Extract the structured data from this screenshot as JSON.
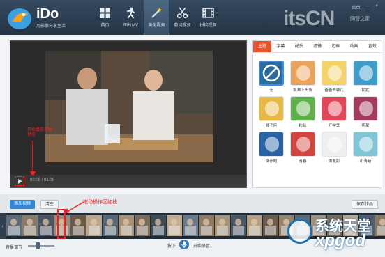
{
  "app": {
    "name": "iDo",
    "slogan": "用影像分享生活"
  },
  "nav": [
    {
      "label": "首页",
      "icon": "grid-icon"
    },
    {
      "label": "图片MV",
      "icon": "dance-icon"
    },
    {
      "label": "美化视频",
      "icon": "magic-wand-icon",
      "active": true
    },
    {
      "label": "剪切视频",
      "icon": "scissors-icon"
    },
    {
      "label": "拼接视频",
      "icon": "film-icon"
    }
  ],
  "top_links": [
    "菜单",
    "—",
    "×"
  ],
  "watermark_top": {
    "main": "itsCN",
    "sub": "网管之家"
  },
  "player": {
    "timecode": "00:08 / 01:08",
    "play_icon": "play-icon",
    "annotation": "开始播放视频预览"
  },
  "tabs": [
    "主题",
    "字幕",
    "配乐",
    "滤镜",
    "边框",
    "动画",
    "音效"
  ],
  "themes": [
    {
      "label": "无",
      "color": "#2d6b9c",
      "selected": true
    },
    {
      "label": "凯蒂上头条",
      "color": "#e9a35a"
    },
    {
      "label": "爸爸去哪儿",
      "color": "#f3d36a"
    },
    {
      "label": "钥匙",
      "color": "#3f9bc9"
    },
    {
      "label": "狮子座",
      "color": "#e6b844"
    },
    {
      "label": "粉丝",
      "color": "#5fb24a"
    },
    {
      "label": "开学季",
      "color": "#e4465a"
    },
    {
      "label": "明星",
      "color": "#a43a5c"
    },
    {
      "label": "倒计时",
      "color": "#2a62a6"
    },
    {
      "label": "青春",
      "color": "#d2443c"
    },
    {
      "label": "微电影",
      "color": "#efefef"
    },
    {
      "label": "小清新",
      "color": "#7fc5d6"
    }
  ],
  "toolbar": {
    "add_label": "添加视频",
    "clear_label": "清空",
    "save_label": "保存作品",
    "annotation": "拖动操作区红线"
  },
  "timeline": {
    "frame_colors": [
      "#5c6b7a",
      "#8a7a6a",
      "#4d5560",
      "#9c8a74",
      "#6b5a48",
      "#b9a68c",
      "#586877",
      "#a89076",
      "#7e6c5a",
      "#3e4c58",
      "#c2ad90",
      "#6a7c8c",
      "#8e7a64",
      "#a4927a",
      "#4a5866",
      "#b5a084",
      "#6c5c4c",
      "#93826e",
      "#5a6a78",
      "#a0907c",
      "#7c6a58",
      "#b8a690",
      "#4f5f6f",
      "#8a7862"
    ]
  },
  "footer": {
    "volume_label": "音量调节",
    "press_label": "按下",
    "record_label": "开始录音"
  },
  "watermark_bottom": {
    "main": "系统天堂",
    "url": "xpgod"
  }
}
